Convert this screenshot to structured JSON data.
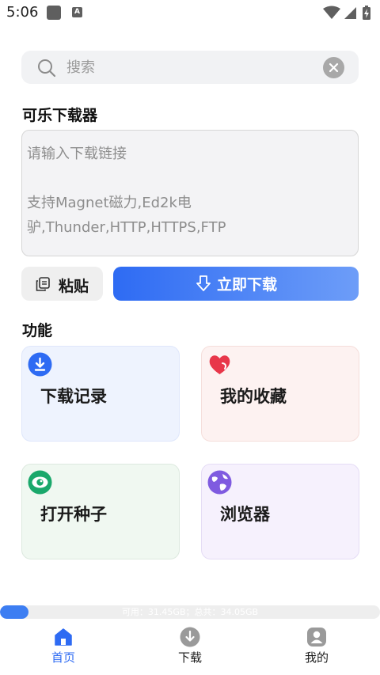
{
  "status_bar": {
    "time": "5:06"
  },
  "search": {
    "placeholder": "搜索"
  },
  "downloader": {
    "title": "可乐下载器",
    "link_placeholder": "请输入下载链接\n\n支持Magnet磁力,Ed2k电驴,Thunder,HTTP,HTTPS,FTP",
    "paste_label": "粘贴",
    "download_label": "立即下载"
  },
  "features": {
    "title": "功能",
    "items": [
      {
        "label": "下载记录",
        "icon": "download-circle-icon"
      },
      {
        "label": "我的收藏",
        "icon": "heart-icon"
      },
      {
        "label": "打开种子",
        "icon": "eye-icon"
      },
      {
        "label": "浏览器",
        "icon": "globe-icon"
      }
    ]
  },
  "storage": {
    "text": "可用：31.45GB；总共：34.05GB",
    "used_fraction": 0.076
  },
  "bottom_nav": {
    "items": [
      {
        "label": "首页",
        "icon": "home-icon",
        "active": true
      },
      {
        "label": "下载",
        "icon": "download-icon",
        "active": false
      },
      {
        "label": "我的",
        "icon": "user-icon",
        "active": false
      }
    ]
  },
  "colors": {
    "accent": "#2e6bf3",
    "accent_light": "#6d9df8",
    "heart": "#e8374a",
    "eye": "#1aa86b",
    "globe": "#7f5be0"
  }
}
